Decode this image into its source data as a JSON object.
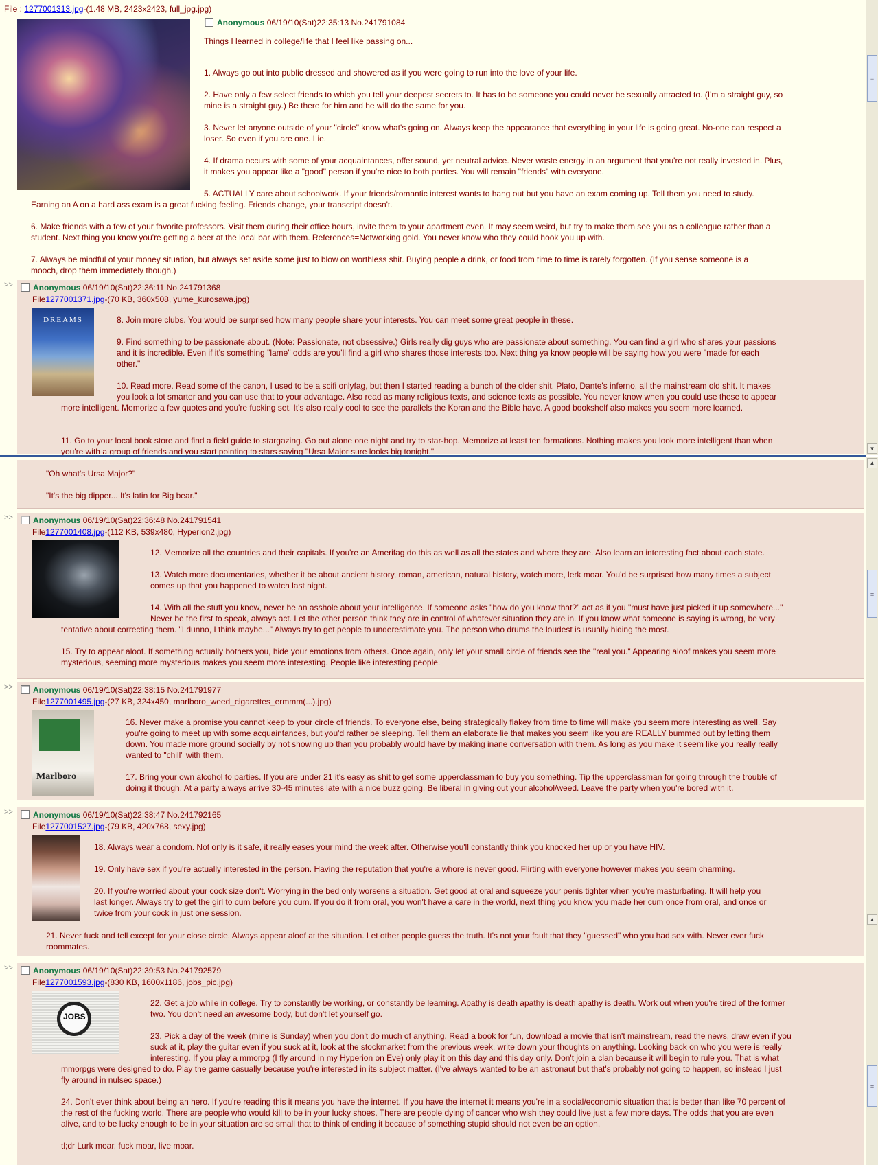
{
  "op": {
    "file_label": "File : ",
    "file_link": "1277001313.jpg",
    "file_meta": "-(1.48 MB, 2423x2423, full_jpg.jpg)",
    "name": "Anonymous",
    "datetime": "06/19/10(Sat)22:35:13",
    "number": "No.241791084",
    "body_first": "Things I learned in college/life that I feel like passing on...",
    "body_rest": "\n1. Always go out into public dressed and showered as if you were going to run into the love of your life.\n\n2. Have only a few select friends to which you tell your deepest secrets to. It has to be someone you could never be sexually attracted to. (I'm a straight guy, so\nmine is a straight guy.) Be there for him and he will do the same for you.\n\n3. Never let anyone outside of your \"circle\" know what's going on. Always keep the appearance that everything in your life is going great. No-one can respect a\nloser. So even if you are one. Lie.\n\n4. If drama occurs with some of your acquaintances, offer sound, yet neutral advice. Never waste energy in an argument that you're not really invested in. Plus,\nit makes you appear like a \"good\" person if you're nice to both parties. You will remain \"friends\" with everyone.\n\n5. ACTUALLY care about schoolwork. If your friends/romantic interest wants to hang out but you have an exam coming up. Tell them you need to study.",
    "body_tail": "Earning an A on a hard ass exam is a great fucking feeling. Friends change, your transcript doesn't.\n\n6. Make friends with a few of your favorite professors. Visit them during their office hours, invite them to your apartment even. It may seem weird, but try to make them see you as a colleague rather than a\nstudent. Next thing you know you're getting a beer at the local bar with them. References=Networking gold. You never know who they could hook you up with.\n\n7. Always be mindful of your money situation, but always set aside some just to blow on worthless shit. Buying people a drink, or food from time to time is rarely forgotten. (If you sense someone is a\nmooch, drop them immediately though.)"
  },
  "replies": [
    {
      "name": "Anonymous",
      "datetime": "06/19/10(Sat)22:36:11",
      "number": "No.241791368",
      "file_label": "File",
      "file_link": "1277001371.jpg",
      "file_meta": "-(70 KB, 360x508, yume_kurosawa.jpg)",
      "thumb_text": "DREAMS",
      "body_a": "8. Join more clubs. You would be surprised how many people share your interests. You can meet some great people in these.\n\n9. Find something to be passionate about. (Note: Passionate, not obsessive.) Girls really dig guys who are passionate about something. You can find a girl who shares your passions\nand it is incredible. Even if it's something \"lame\" odds are you'll find a girl who shares those interests too. Next thing ya know people will be saying how you were \"made for each\nother.\"\n\n10. Read more. Read some of the canon, I used to be a scifi onlyfag, but then I started reading a bunch of the older shit. Plato, Dante's inferno, all the mainstream old shit. It makes\nyou look a lot smarter and you can use that to your advantage. Also read as many religious texts, and science texts as possible. You never know when you could use these to appear",
      "body_b": "more intelligent. Memorize a few quotes and you're fucking set. It's also really cool to see the parallels the Koran and the Bible have. A good bookshelf also makes you seem more learned.\n\n\n11. Go to your local book store and find a field guide to stargazing. Go out alone one night and try to star-hop. Memorize at least ten formations. Nothing makes you look more intelligent than when\nyou're with a group of friends and you start pointing to stars saying \"Ursa Major sure looks big tonight.\"",
      "body_c": "\"Oh what's Ursa Major?\"\n\n\"It's the big dipper... It's latin for Big bear.\""
    },
    {
      "name": "Anonymous",
      "datetime": "06/19/10(Sat)22:36:48",
      "number": "No.241791541",
      "file_label": "File",
      "file_link": "1277001408.jpg",
      "file_meta": "-(112 KB, 539x480, Hyperion2.jpg)",
      "body_a": "12. Memorize all the countries and their capitals. If you're an Amerifag do this as well as all the states and where they are. Also learn an interesting fact about each state.\n\n13. Watch more documentaries, whether it be about ancient history, roman, american, natural history, watch more, lerk moar. You'd be surprised how many times a subject\ncomes up that you happened to watch last night.\n\n14. With all the stuff you know, never be an asshole about your intelligence. If someone asks \"how do you know that?\" act as if you \"must have just picked it up somewhere...\"\nNever be the first to speak, always act. Let the other person think they are in control of whatever situation they are in. If you know what someone is saying is wrong, be very",
      "body_b": "tentative about correcting them. \"I dunno, I think maybe...\" Always try to get people to underestimate you. The person who drums the loudest is usually hiding the most.\n\n15. Try to appear aloof. If something actually bothers you, hide your emotions from others. Once again, only let your small circle of friends see the \"real you.\" Appearing aloof makes you seem more\nmysterious, seeming more mysterious makes you seem more interesting. People like interesting people."
    },
    {
      "name": "Anonymous",
      "datetime": "06/19/10(Sat)22:38:15",
      "number": "No.241791977",
      "file_label": "File",
      "file_link": "1277001495.jpg",
      "file_meta": "-(27 KB, 324x450, marlboro_weed_cigarettes_ermmm(...).jpg)",
      "thumb_text": "Marlboro",
      "body_a": "16. Never make a promise you cannot keep to your circle of friends. To everyone else, being strategically flakey from time to time will make you seem more interesting as well. Say\nyou're going to meet up with some acquaintances, but you'd rather be sleeping. Tell them an elaborate lie that makes you seem like you are REALLY bummed out by letting them\ndown. You made more ground socially by not showing up than you probably would have by making inane conversation with them. As long as you make it seem like you really really\nwanted to \"chill\" with them.\n\n17. Bring your own alcohol to parties. If you are under 21 it's easy as shit to get some upperclassman to buy you something. Tip the upperclassman for going through the trouble of\ndoing it though. At a party always arrive 30-45 minutes late with a nice buzz going. Be liberal in giving out your alcohol/weed. Leave the party when you're bored with it."
    },
    {
      "name": "Anonymous",
      "datetime": "06/19/10(Sat)22:38:47",
      "number": "No.241792165",
      "file_label": "File",
      "file_link": "1277001527.jpg",
      "file_meta": "-(79 KB, 420x768, sexy.jpg)",
      "body_a": "18. Always wear a condom. Not only is it safe, it really eases your mind the week after. Otherwise you'll constantly think you knocked her up or you have HIV.\n\n19. Only have sex if you're actually interested in the person. Having the reputation that you're a whore is never good. Flirting with everyone however makes you seem charming.\n\n20. If you're worried about your cock size don't. Worrying in the bed only worsens a situation. Get good at oral and squeeze your penis tighter when you're masturbating. It will help you\nlast longer. Always try to get the girl to cum before you cum. If you do it from oral, you won't have a care in the world, next thing you know you made her cum once from oral, and once or\ntwice from your cock in just one session.",
      "body_b": "21. Never fuck and tell except for your close circle. Always appear aloof at the situation. Let other people guess the truth. It's not your fault that they \"guessed\" who you had sex with. Never ever fuck\nroommates."
    },
    {
      "name": "Anonymous",
      "datetime": "06/19/10(Sat)22:39:53",
      "number": "No.241792579",
      "file_label": "File",
      "file_link": "1277001593.jpg",
      "file_meta": "-(830 KB, 1600x1186, jobs_pic.jpg)",
      "thumb_text": "JOBS",
      "body_a": "22. Get a job while in college. Try to constantly be working, or constantly be learning. Apathy is death apathy is death apathy is death. Work out when you're tired of the former\ntwo. You don't need an awesome body, but don't let yourself go.\n\n23. Pick a day of the week (mine is Sunday) when you don't do much of anything. Read a book for fun, download a movie that isn't mainstream, read the news, draw even if you\nsuck at it, play the guitar even if you suck at it, look at the stockmarket from the previous week, write down your thoughts on anything. Looking back on who you were is really\ninteresting. If you play a mmorpg (I fly around in my Hyperion on Eve) only play it on this day and this day only. Don't join a clan because it will begin to rule you. That is what",
      "body_b": "mmorpgs were designed to do. Play the game casually because you're interested in its subject matter. (I've always wanted to be an astronaut but that's probably not going to happen, so instead I just\nfly around in nulsec space.)\n\n24. Don't ever think about being an hero. If you're reading this it means you have the internet. If you have the internet it means you're in a social/economic situation that is better than like 70 percent of\nthe rest of the fucking world. There are people who would kill to be in your lucky shoes. There are people dying of cancer who wish they could live just a few more days. The odds that you are even\nalive, and to be lucky enough to be in your situation are so small that to think of ending it because of something stupid should not even be an option.\n\ntl;dr Lurk moar, fuck moar, live moar."
    }
  ],
  "arrows": ">>"
}
